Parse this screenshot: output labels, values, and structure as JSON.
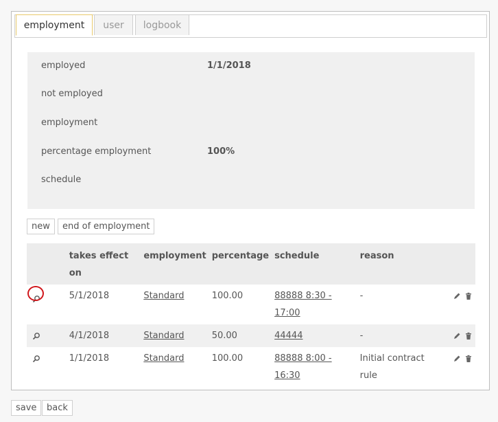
{
  "tabs": [
    {
      "label": "employment",
      "active": true
    },
    {
      "label": "user",
      "active": false
    },
    {
      "label": "logbook",
      "active": false
    }
  ],
  "info": {
    "employed_label": "employed",
    "employed_value": "1/1/2018",
    "not_employed_label": "not employed",
    "employment_label": "employment",
    "percentage_label": "percentage employment",
    "percentage_value": "100%",
    "schedule_label": "schedule"
  },
  "actions": {
    "new_label": "new",
    "end_label": "end of employment"
  },
  "table": {
    "headers": [
      "takes effect on",
      "employment",
      "percentage",
      "schedule",
      "reason"
    ],
    "rows": [
      {
        "takes_effect": "5/1/2018",
        "employment": "Standard",
        "percentage": "100.00",
        "schedule": "88888 8:30 - 17:00",
        "reason": "-"
      },
      {
        "takes_effect": "4/1/2018",
        "employment": "Standard",
        "percentage": "50.00",
        "schedule": "44444",
        "reason": "-"
      },
      {
        "takes_effect": "1/1/2018",
        "employment": "Standard",
        "percentage": "100.00",
        "schedule": "88888 8:00 - 16:30",
        "reason": "Initial contract rule"
      }
    ]
  },
  "footer": {
    "save_label": "save",
    "back_label": "back"
  },
  "icons": {
    "view": "magnifier-icon",
    "edit": "pencil-icon",
    "delete": "trash-icon"
  },
  "colors": {
    "highlight": "#d0161b",
    "active_tab_border": "#e8c96b"
  }
}
